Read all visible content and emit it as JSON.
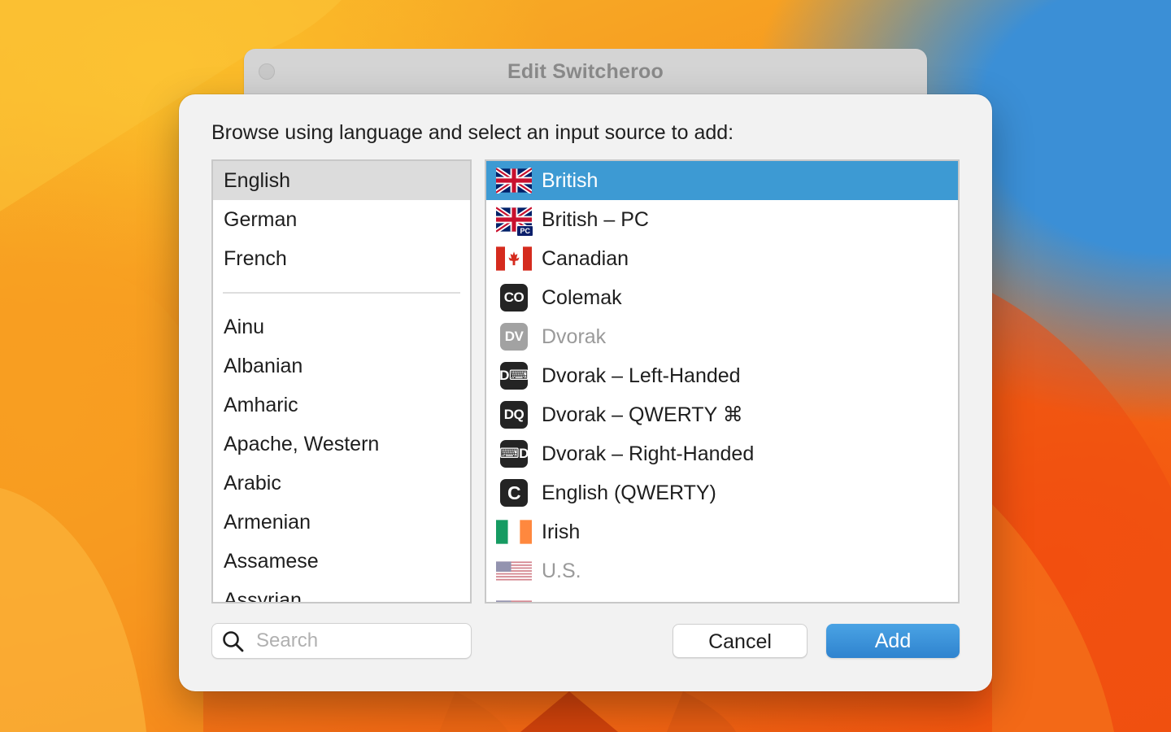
{
  "window": {
    "title": "Edit Switcheroo"
  },
  "sheet": {
    "prompt": "Browse using language and select an input source to add:"
  },
  "languages": {
    "selected": "English",
    "preferred": [
      "English",
      "German",
      "French"
    ],
    "all": [
      "Ainu",
      "Albanian",
      "Amharic",
      "Apache, Western",
      "Arabic",
      "Armenian",
      "Assamese",
      "Assyrian"
    ]
  },
  "sources": {
    "selected": "British",
    "items": [
      {
        "label": "British",
        "icon": "uk-flag-icon"
      },
      {
        "label": "British – PC",
        "icon": "uk-flag-pc-icon",
        "badge": "PC"
      },
      {
        "label": "Canadian",
        "icon": "canada-flag-icon"
      },
      {
        "label": "Colemak",
        "icon": "colemak-key-icon",
        "key": "CO"
      },
      {
        "label": "Dvorak",
        "icon": "dvorak-key-icon",
        "key": "DV"
      },
      {
        "label": "Dvorak – Left-Handed",
        "icon": "dvorak-left-key-icon",
        "key": "D⌨"
      },
      {
        "label": "Dvorak – QWERTY ⌘",
        "icon": "dvorak-qwerty-key-icon",
        "key": "DQ"
      },
      {
        "label": "Dvorak – Right-Handed",
        "icon": "dvorak-right-key-icon",
        "key": "⌨D"
      },
      {
        "label": "English (QWERTY)",
        "icon": "english-qwerty-key-icon",
        "key": "C"
      },
      {
        "label": "Irish",
        "icon": "ireland-flag-icon"
      },
      {
        "label": "U.S.",
        "icon": "us-flag-icon"
      }
    ]
  },
  "search": {
    "placeholder": "Search",
    "value": ""
  },
  "buttons": {
    "cancel": "Cancel",
    "add": "Add"
  },
  "colors": {
    "selection_blue": "#3d9ad3",
    "add_button_blue": "#2f83cf",
    "list_selected_gray": "#dcdcdc"
  }
}
